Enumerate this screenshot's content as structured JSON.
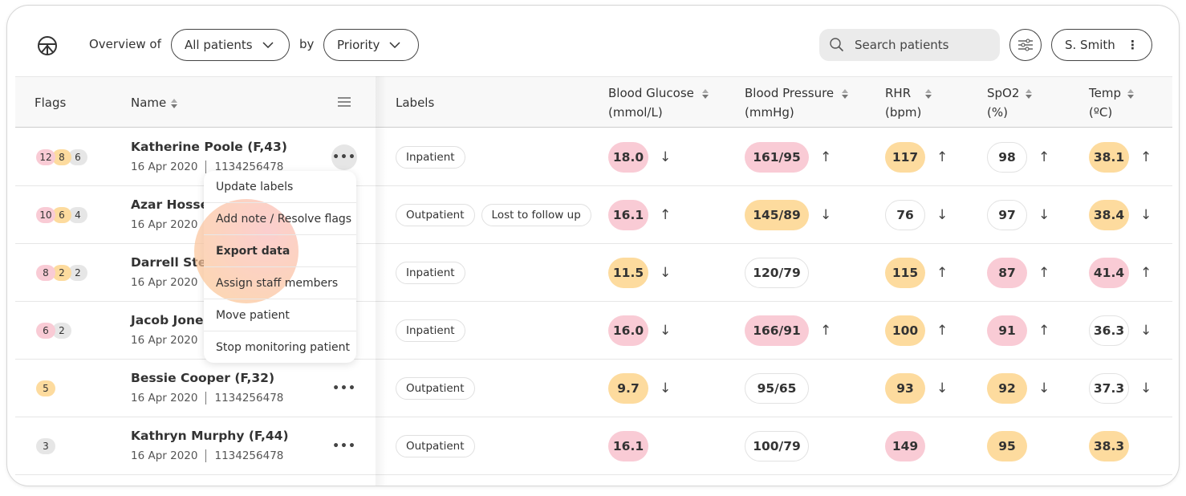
{
  "header": {
    "overview_label": "Overview of",
    "patients_select": "All patients",
    "by_label": "by",
    "sort_select": "Priority",
    "search_placeholder": "Search patients",
    "user": "S. Smith"
  },
  "colors": {
    "pink": "#f9cbd5",
    "orange": "#fddb9e",
    "gray": "#e6e6e6",
    "white": "#ffffff"
  },
  "columns": {
    "flags": "Flags",
    "name": "Name",
    "labels": "Labels",
    "bg": [
      "Blood Glucose",
      "(mmol/L)"
    ],
    "bp": [
      "Blood Pressure",
      "(mmHg)"
    ],
    "rhr": [
      "RHR",
      "(bpm)"
    ],
    "spo2": [
      "SpO2",
      "(%)"
    ],
    "temp": [
      "Temp",
      "(ºC)"
    ]
  },
  "rows": [
    {
      "flags": [
        [
          "12",
          "pink"
        ],
        [
          "8",
          "orange"
        ],
        [
          "6",
          "gray"
        ]
      ],
      "name": "Katherine Poole (F,43)",
      "date": "16 Apr 2020",
      "id": "1134256478",
      "menu_open": true,
      "labels": [
        "Inpatient"
      ],
      "vitals": [
        [
          "18.0",
          "pink",
          "↓"
        ],
        [
          "161/95",
          "pink",
          "↑"
        ],
        [
          "117",
          "orange",
          "↑"
        ],
        [
          "98",
          "white",
          "↑"
        ],
        [
          "38.1",
          "orange",
          "↑"
        ]
      ]
    },
    {
      "flags": [
        [
          "10",
          "pink"
        ],
        [
          "6",
          "orange"
        ],
        [
          "4",
          "gray"
        ]
      ],
      "name": "Azar Hossei",
      "date": "16 Apr 2020",
      "id": "",
      "labels": [
        "Outpatient",
        "Lost to follow up"
      ],
      "vitals": [
        [
          "16.1",
          "pink",
          "↑"
        ],
        [
          "145/89",
          "orange",
          "↓"
        ],
        [
          "76",
          "white",
          "↓"
        ],
        [
          "97",
          "white",
          "↓"
        ],
        [
          "38.4",
          "orange",
          "↓"
        ]
      ]
    },
    {
      "flags": [
        [
          "8",
          "pink"
        ],
        [
          "2",
          "orange"
        ],
        [
          "2",
          "gray"
        ]
      ],
      "name": "Darrell Stew",
      "date": "16 Apr 2020",
      "id": "",
      "labels": [
        "Inpatient"
      ],
      "vitals": [
        [
          "11.5",
          "orange",
          "↓"
        ],
        [
          "120/79",
          "white",
          ""
        ],
        [
          "115",
          "orange",
          "↑"
        ],
        [
          "87",
          "pink",
          "↑"
        ],
        [
          "41.4",
          "pink",
          "↑"
        ]
      ]
    },
    {
      "flags": [
        [
          "6",
          "pink"
        ],
        [
          "2",
          "gray"
        ]
      ],
      "name": "Jacob Jones",
      "date": "16 Apr 2020",
      "id": "",
      "labels": [
        "Inpatient"
      ],
      "vitals": [
        [
          "16.0",
          "pink",
          "↓"
        ],
        [
          "166/91",
          "pink",
          "↑"
        ],
        [
          "100",
          "orange",
          "↑"
        ],
        [
          "91",
          "pink",
          "↑"
        ],
        [
          "36.3",
          "white",
          "↓"
        ]
      ]
    },
    {
      "flags": [
        [
          "5",
          "orange"
        ]
      ],
      "name": "Bessie Cooper (F,32)",
      "date": "16 Apr 2020",
      "id": "1134256478",
      "labels": [
        "Outpatient"
      ],
      "vitals": [
        [
          "9.7",
          "orange",
          "↓"
        ],
        [
          "95/65",
          "white",
          ""
        ],
        [
          "93",
          "orange",
          "↓"
        ],
        [
          "92",
          "orange",
          "↓"
        ],
        [
          "37.3",
          "white",
          "↓"
        ]
      ]
    },
    {
      "flags": [
        [
          "3",
          "gray"
        ]
      ],
      "name": "Kathryn Murphy (F,44)",
      "date": "16 Apr 2020",
      "id": "1134256478",
      "labels": [
        "Outpatient"
      ],
      "vitals": [
        [
          "16.1",
          "pink",
          ""
        ],
        [
          "100/79",
          "white",
          ""
        ],
        [
          "149",
          "pink",
          ""
        ],
        [
          "95",
          "orange",
          ""
        ],
        [
          "38.3",
          "orange",
          ""
        ]
      ]
    }
  ],
  "menu": {
    "items": [
      "Update labels",
      "Add note / Resolve flags",
      "Export data",
      "Assign staff members",
      "Move patient",
      "Stop monitoring patient"
    ],
    "highlighted": "Export data"
  },
  "icons": {
    "logo": "logo-icon",
    "search": "search-icon",
    "filter": "sliders-icon",
    "more": "more-horizontal-icon",
    "kebab": "more-vertical-icon",
    "column_menu": "menu-lines-icon"
  }
}
